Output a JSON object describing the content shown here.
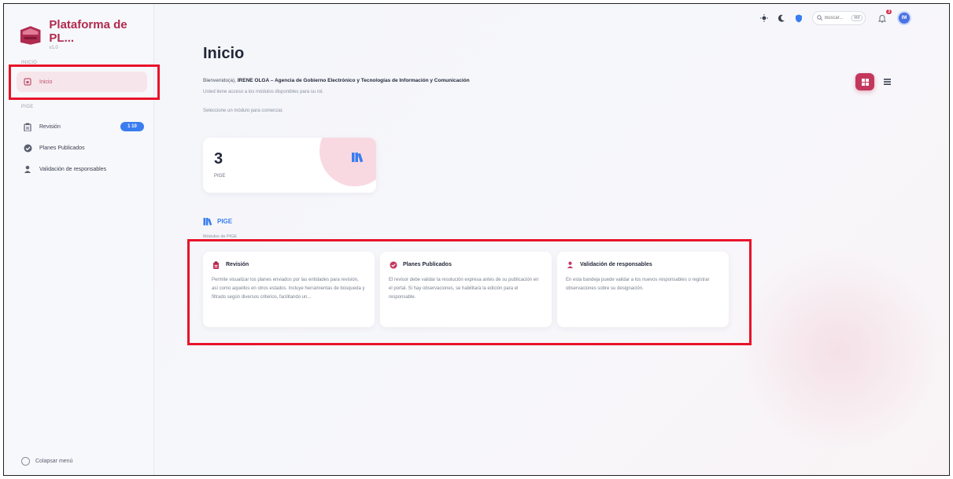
{
  "brand": {
    "title": "Plataforma de PL...",
    "version": "v1.0"
  },
  "sidebar": {
    "section_inicio": "INICIO",
    "section_pige": "PIGE",
    "items": [
      {
        "label": "Inicio",
        "icon": "home-icon",
        "active": true
      },
      {
        "label": "Revisión",
        "icon": "clipboard-icon",
        "badge": "1 10"
      },
      {
        "label": "Planes Publicados",
        "icon": "check-badge-icon"
      },
      {
        "label": "Validación de responsables",
        "icon": "user-check-icon"
      }
    ],
    "collapse_label": "Colapsar menú"
  },
  "topbar": {
    "search_placeholder": "Buscar...",
    "search_shortcut": "⌘K",
    "notification_count": "3",
    "avatar_initials": "IM"
  },
  "main": {
    "title": "Inicio",
    "welcome_prefix": "Bienvenido(a), ",
    "welcome_name": "IRENE OLGA",
    "welcome_suffix": " – Agencia de Gobierno Electrónico y Tecnologías de Información y Comunicación",
    "access_text": "Usted tiene acceso a los módulos disponibles para su rol.",
    "select_text": "Seleccione un módulo para comenzar.",
    "stat": {
      "value": "3",
      "label": "PIGE"
    },
    "section_title": "PIGE",
    "section_subtitle": "Módulos de PIGE",
    "modules": [
      {
        "title": "Revisión",
        "icon": "clipboard-icon",
        "desc": "Permite visualizar los planes enviados por las entidades para revisión, así como aquellos en otros estados. Incluye herramientas de búsqueda y filtrado según diversos criterios, facilitando un..."
      },
      {
        "title": "Planes Publicados",
        "icon": "check-badge-icon",
        "desc": "El revisor debe validar la resolución expresa antes de su publicación en el portal. Si hay observaciones, se habilitará la edición para el responsable."
      },
      {
        "title": "Validación de responsables",
        "icon": "user-check-icon",
        "desc": "En esta bandeja puede validar a los nuevos responsables o registrar observaciones sobre su designación."
      }
    ]
  },
  "colors": {
    "accent": "#c4375d",
    "brand": "#b02a4f",
    "blue": "#3a7df0",
    "highlight": "#e8132a"
  }
}
